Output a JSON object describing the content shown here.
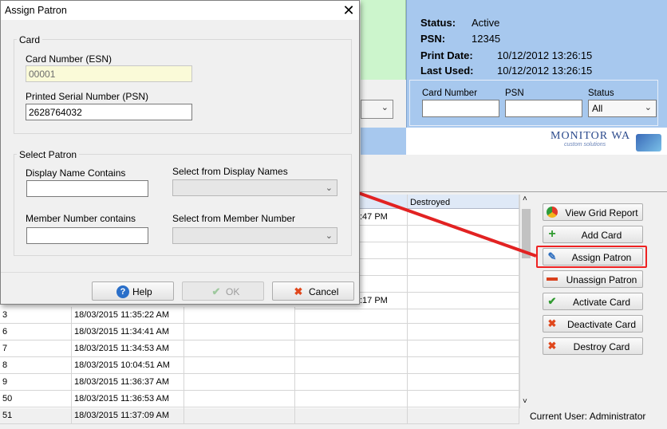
{
  "dialog": {
    "title": "Assign Patron",
    "card_group": {
      "legend": "Card",
      "card_number_label": "Card Number (ESN)",
      "card_number_value": "00001",
      "psn_label": "Printed Serial Number (PSN)",
      "psn_value": "2628764032"
    },
    "select_group": {
      "legend": "Select Patron",
      "display_name_label": "Display Name Contains",
      "display_name_value": "",
      "select_display_label": "Select from Display Names",
      "select_display_value": "",
      "member_number_label": "Member Number contains",
      "member_number_value": "",
      "select_member_label": "Select from Member Number",
      "select_member_value": ""
    },
    "buttons": {
      "help": "Help",
      "ok": "OK",
      "cancel": "Cancel"
    }
  },
  "status": {
    "status_label": "Status:",
    "status_value": "Active",
    "psn_label": "PSN:",
    "psn_value": "12345",
    "print_date_label": "Print Date:",
    "print_date_value": "10/12/2012 13:26:15",
    "last_used_label": "Last Used:",
    "last_used_value": "10/12/2012 13:26:15"
  },
  "filters": {
    "card_number_label": "Card Number",
    "card_number_value": "",
    "psn_label": "PSN",
    "psn_value": "",
    "status_label": "Status",
    "status_value": "All"
  },
  "logo": {
    "name": "MONITOR WA",
    "tagline": "custom solutions"
  },
  "grid": {
    "destroyed_header": "Destroyed",
    "partial_top": [
      ":47 PM",
      ":17 PM"
    ],
    "rows": [
      {
        "id": "3",
        "time": "18/03/2015 11:35:22 AM"
      },
      {
        "id": "6",
        "time": "18/03/2015 11:34:41 AM"
      },
      {
        "id": "7",
        "time": "18/03/2015 11:34:53 AM"
      },
      {
        "id": "8",
        "time": "18/03/2015 10:04:51 AM"
      },
      {
        "id": "9",
        "time": "18/03/2015 11:36:37 AM"
      },
      {
        "id": "50",
        "time": "18/03/2015 11:36:53 AM"
      },
      {
        "id": "51",
        "time": "18/03/2015 11:37:09 AM"
      }
    ]
  },
  "actions": {
    "view_grid_report": "View Grid Report",
    "add_card": "Add Card",
    "assign_patron": "Assign Patron",
    "unassign_patron": "Unassign Patron",
    "activate_card": "Activate Card",
    "deactivate_card": "Deactivate Card",
    "destroy_card": "Destroy Card"
  },
  "footer": {
    "current_user": "Current User: Administrator"
  },
  "colors": {
    "highlight": "#e22222",
    "status_panel": "#a7c8ee",
    "arrow": "#e22222"
  }
}
